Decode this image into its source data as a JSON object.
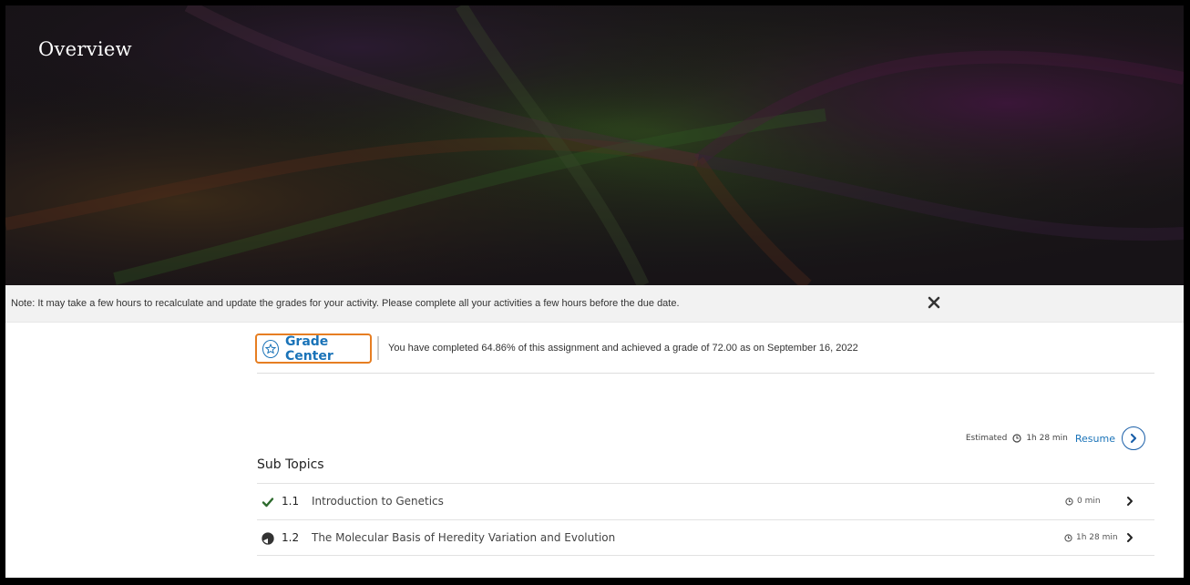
{
  "hero": {
    "title": "Overview"
  },
  "note": {
    "text": "Note: It may take a few hours to recalculate and update the grades for your activity. Please complete all your activities a few hours before the due date."
  },
  "grade": {
    "label": "Grade Center",
    "message": "You have completed 64.86% of this assignment and achieved a grade of 72.00 as on September 16, 2022"
  },
  "resume": {
    "estimated_label": "Estimated",
    "time": "1h 28 min",
    "link": "Resume"
  },
  "subtopics": {
    "title": "Sub Topics",
    "items": [
      {
        "number": "1.1",
        "name": "Introduction to Genetics",
        "time": "0 min",
        "status": "completed"
      },
      {
        "number": "1.2",
        "name": "The Molecular Basis of Heredity Variation and Evolution",
        "time": "1h 28 min",
        "status": "in-progress"
      }
    ]
  },
  "colors": {
    "accent": "#1a73b8",
    "highlight": "#e67e22"
  }
}
